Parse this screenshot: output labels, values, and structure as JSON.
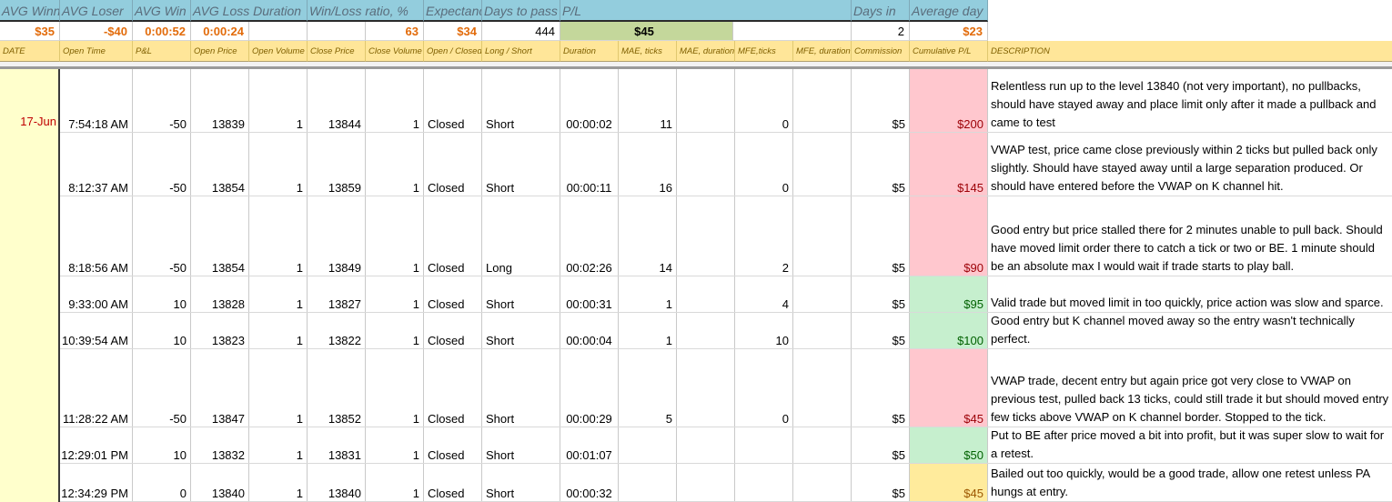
{
  "summary": {
    "headers": [
      "AVG Winner",
      "AVG Loser",
      "AVG Win Duration",
      "AVG Loss Duration",
      "Win/Loss ratio, %",
      "Expectancy",
      "Days to pass",
      "P/L",
      "Days in",
      "Average day"
    ],
    "values": {
      "avg_winner": "$35",
      "avg_loser": "-$40",
      "avg_win_duration": "0:00:52",
      "avg_loss_duration": "0:00:24",
      "win_loss_ratio": "63",
      "expectancy": "$34",
      "days_to_pass": "444",
      "pl": "$45",
      "days_in": "2",
      "average_day": "$23"
    }
  },
  "columns": [
    "DATE",
    "Open Time",
    "P&L",
    "Open Price",
    "Open Volume",
    "Close Price",
    "Close Volume",
    "Open / Closed",
    "Long / Short",
    "Duration",
    "MAE, ticks",
    "MAE, duration",
    "MFE,ticks",
    "MFE, duration",
    "Commission",
    "Cumulative P/L",
    "DESCRIPTION"
  ],
  "date": "17-Jun",
  "trades": [
    {
      "open_time": "7:54:18 AM",
      "pl": "-50",
      "open_price": "13839",
      "open_vol": "1",
      "close_price": "13844",
      "close_vol": "1",
      "status": "Closed",
      "side": "Short",
      "duration": "00:00:02",
      "mae_ticks": "11",
      "mfe_ticks": "0",
      "commission": "$5",
      "cum_pl": "$200",
      "cum_color": "red",
      "description": "Relentless run up to the level 13840 (not very important), no pullbacks, should have stayed away and place limit only after it made a pullback and came to test"
    },
    {
      "open_time": "8:12:37 AM",
      "pl": "-50",
      "open_price": "13854",
      "open_vol": "1",
      "close_price": "13859",
      "close_vol": "1",
      "status": "Closed",
      "side": "Short",
      "duration": "00:00:11",
      "mae_ticks": "16",
      "mfe_ticks": "0",
      "commission": "$5",
      "cum_pl": "$145",
      "cum_color": "red",
      "description": "VWAP test, price came close previously within 2 ticks but pulled back only slightly. Should have stayed away until a large separation produced. Or should have entered before the VWAP on K channel hit."
    },
    {
      "open_time": "8:18:56 AM",
      "pl": "-50",
      "open_price": "13854",
      "open_vol": "1",
      "close_price": "13849",
      "close_vol": "1",
      "status": "Closed",
      "side": "Long",
      "duration": "00:02:26",
      "mae_ticks": "14",
      "mfe_ticks": "2",
      "commission": "$5",
      "cum_pl": "$90",
      "cum_color": "red",
      "description": "Good entry but price stalled there for 2 minutes unable to pull back. Should have moved limit order there to catch a tick or two or BE. 1 minute should be an absolute max I would wait if trade starts to play ball."
    },
    {
      "open_time": "9:33:00 AM",
      "pl": "10",
      "open_price": "13828",
      "open_vol": "1",
      "close_price": "13827",
      "close_vol": "1",
      "status": "Closed",
      "side": "Short",
      "duration": "00:00:31",
      "mae_ticks": "1",
      "mfe_ticks": "4",
      "commission": "$5",
      "cum_pl": "$95",
      "cum_color": "green",
      "description": "Valid trade but moved limit in too quickly, price action was slow and sparce."
    },
    {
      "open_time": "10:39:54 AM",
      "pl": "10",
      "open_price": "13823",
      "open_vol": "1",
      "close_price": "13822",
      "close_vol": "1",
      "status": "Closed",
      "side": "Short",
      "duration": "00:00:04",
      "mae_ticks": "1",
      "mfe_ticks": "10",
      "commission": "$5",
      "cum_pl": "$100",
      "cum_color": "green",
      "description": "Good entry but K channel moved away so the entry wasn't technically perfect."
    },
    {
      "open_time": "11:28:22 AM",
      "pl": "-50",
      "open_price": "13847",
      "open_vol": "1",
      "close_price": "13852",
      "close_vol": "1",
      "status": "Closed",
      "side": "Short",
      "duration": "00:00:29",
      "mae_ticks": "5",
      "mfe_ticks": "0",
      "commission": "$5",
      "cum_pl": "$45",
      "cum_color": "red",
      "description": "VWAP trade, decent entry but again price got very close to VWAP on previous test, pulled back 13 ticks, could still trade it but should moved entry few ticks above VWAP on K channel border. Stopped to the tick."
    },
    {
      "open_time": "12:29:01 PM",
      "pl": "10",
      "open_price": "13832",
      "open_vol": "1",
      "close_price": "13831",
      "close_vol": "1",
      "status": "Closed",
      "side": "Short",
      "duration": "00:01:07",
      "mae_ticks": "",
      "mfe_ticks": "",
      "commission": "$5",
      "cum_pl": "$50",
      "cum_color": "green",
      "description": "Put to BE after price moved a bit into profit, but it was super slow to wait for a retest."
    },
    {
      "open_time": "12:34:29 PM",
      "pl": "0",
      "open_price": "13840",
      "open_vol": "1",
      "close_price": "13840",
      "close_vol": "1",
      "status": "Closed",
      "side": "Short",
      "duration": "00:00:32",
      "mae_ticks": "",
      "mfe_ticks": "",
      "commission": "$5",
      "cum_pl": "$45",
      "cum_color": "yellow",
      "description": "Bailed out too quickly, would be a good trade, allow one retest unless PA hungs at entry."
    }
  ]
}
